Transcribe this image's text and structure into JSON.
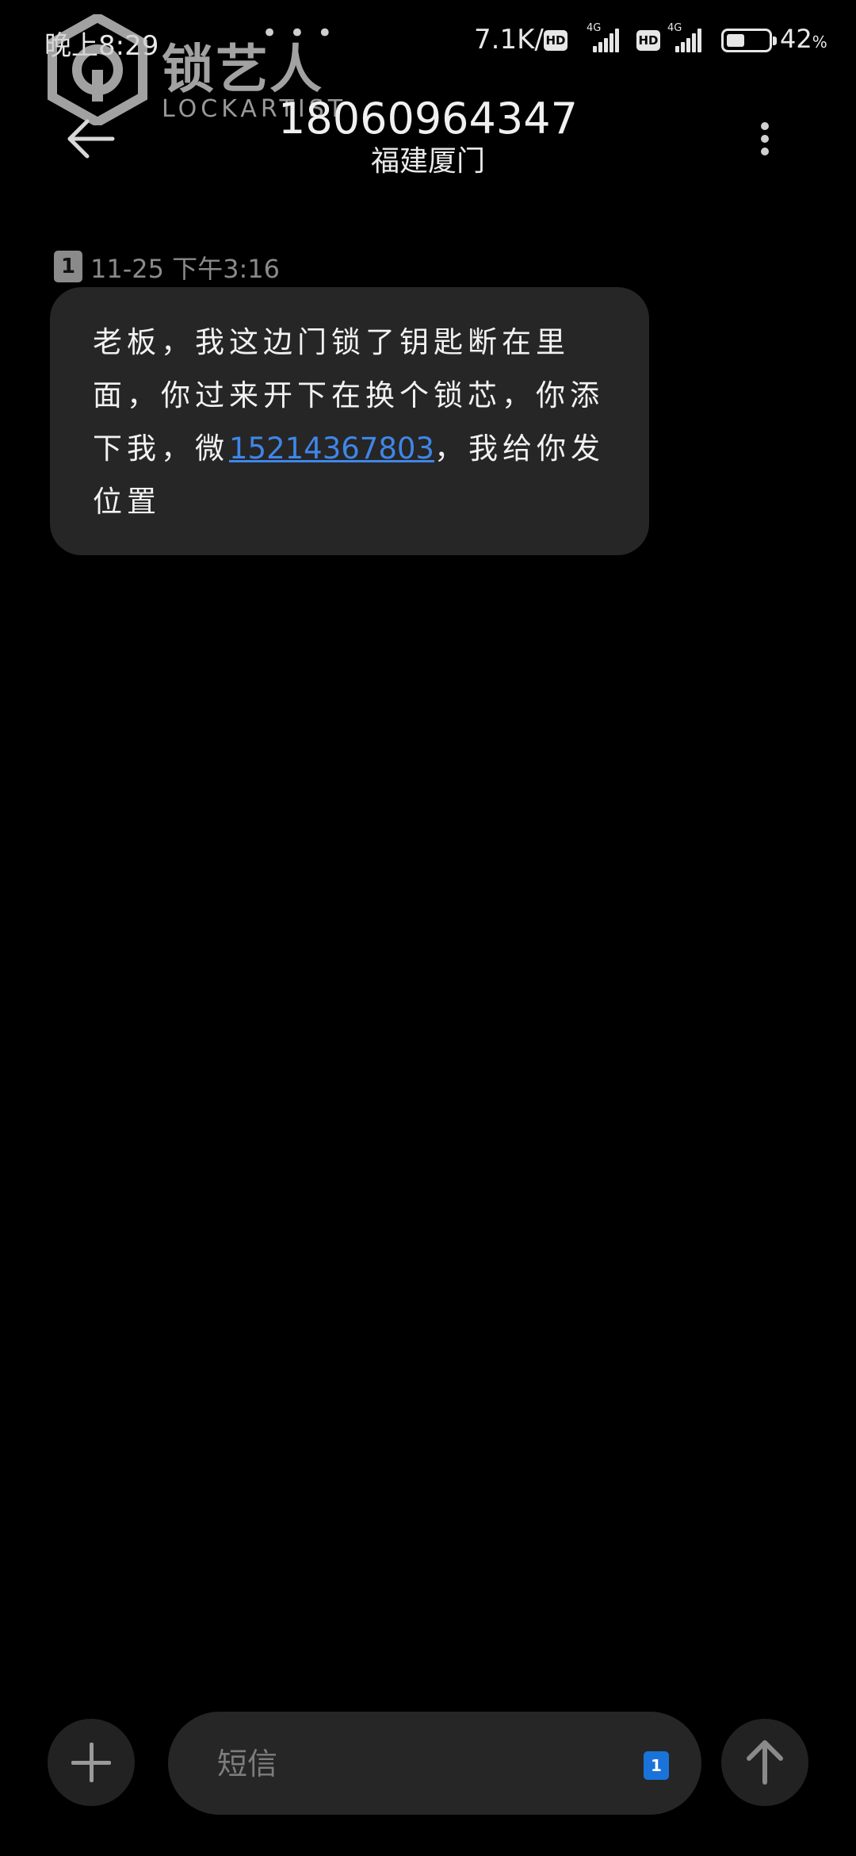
{
  "status_bar": {
    "time": "晚上8:29",
    "notification_dots": "• • •",
    "network_speed": "7.1K/s",
    "hd_label": "HD",
    "sim1_network": "4G",
    "sim2_network": "4G",
    "battery_percent": "42",
    "battery_unit": "%",
    "battery_level": 0.42
  },
  "watermark": {
    "brand_cn": "锁艺人",
    "brand_en": "LOCKARTIST"
  },
  "header": {
    "phone_number": "18060964347",
    "location": "福建厦门",
    "back_icon": "arrow-left-icon",
    "more_icon": "vertical-dots-icon"
  },
  "conversation": {
    "messages": [
      {
        "sim_slot": "1",
        "timestamp": "11-25 下午3:16",
        "text_before_link": "老板，我这边门锁了钥匙断在里面，你过来开下在换个锁芯，你添下我，微",
        "link_text": "15214367803",
        "text_after_link": "，我给你发位置"
      }
    ]
  },
  "composer": {
    "placeholder": "短信",
    "sim_slot": "1",
    "add_icon": "plus-icon",
    "send_icon": "arrow-up-icon"
  },
  "colors": {
    "background": "#000000",
    "bubble": "#262626",
    "link": "#3f86e8",
    "sim_badge": "#1a73d9"
  }
}
